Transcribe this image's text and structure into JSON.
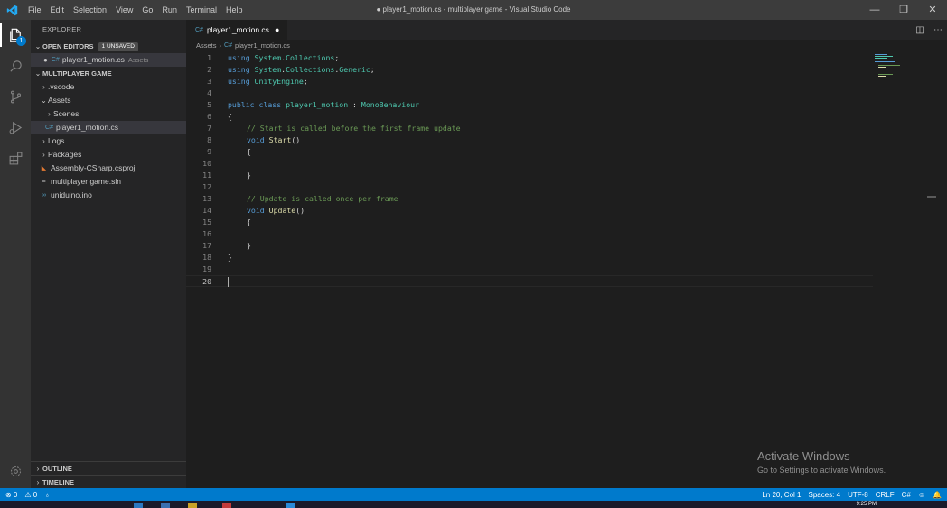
{
  "titlebar": {
    "menu": [
      "File",
      "Edit",
      "Selection",
      "View",
      "Go",
      "Run",
      "Terminal",
      "Help"
    ],
    "window_title": "● player1_motion.cs - multiplayer game - Visual Studio Code",
    "controls": [
      "—",
      "❐",
      "✕"
    ]
  },
  "activitybar": {
    "explorer_badge": "1"
  },
  "sidebar": {
    "title": "EXPLORER",
    "open_editors": {
      "label": "OPEN EDITORS",
      "badge": "1 UNSAVED",
      "file": "player1_motion.cs",
      "desc": "Assets"
    },
    "workspace": {
      "label": "MULTIPLAYER GAME"
    },
    "tree": {
      "vscode": ".vscode",
      "assets": "Assets",
      "scenes": "Scenes",
      "player_motion": "player1_motion.cs",
      "logs": "Logs",
      "packages": "Packages",
      "csproj": "Assembly-CSharp.csproj",
      "sln": "multiplayer game.sln",
      "ino": "uniduino.ino"
    },
    "outline": "OUTLINE",
    "timeline": "TIMELINE"
  },
  "editor": {
    "tab_label": "player1_motion.cs",
    "tab_modified": "●",
    "breadcrumb": {
      "folder": "Assets",
      "file": "player1_motion.cs"
    },
    "line_numbers": [
      "1",
      "2",
      "3",
      "4",
      "5",
      "6",
      "7",
      "8",
      "9",
      "10",
      "11",
      "12",
      "13",
      "14",
      "15",
      "16",
      "17",
      "18",
      "19",
      "20"
    ],
    "code": {
      "l1_kw": "using",
      "l1_ns": "System",
      "l1_dot": ".",
      "l1_ns2": "Collections",
      "l1_end": ";",
      "l2_kw": "using",
      "l2_ns": "System",
      "l2_dot": ".",
      "l2_ns2": "Collections",
      "l2_dot2": ".",
      "l2_ns3": "Generic",
      "l2_end": ";",
      "l3_kw": "using",
      "l3_ns": "UnityEngine",
      "l3_end": ";",
      "l5_kw1": "public",
      "l5_kw2": "class",
      "l5_name": "player1_motion",
      "l5_colon": " : ",
      "l5_base": "MonoBehaviour",
      "l6": "{",
      "l7": "// Start is called before the first frame update",
      "l8_kw": "void",
      "l8_fn": "Start",
      "l8_p": "()",
      "l9": "{",
      "l11": "}",
      "l13": "// Update is called once per frame",
      "l14_kw": "void",
      "l14_fn": "Update",
      "l14_p": "()",
      "l15": "{",
      "l17": "}",
      "l18": "}"
    }
  },
  "watermark": {
    "title": "Activate Windows",
    "subtitle": "Go to Settings to activate Windows."
  },
  "statusbar": {
    "errors": "⊗ 0",
    "warnings": "⚠ 0",
    "live": "♁",
    "position": "Ln 20, Col 1",
    "spaces": "Spaces: 4",
    "encoding": "UTF-8",
    "eol": "CRLF",
    "language": "C#",
    "feedback": "☺",
    "notifications": "🔔"
  },
  "taskbar": {
    "clock": "9:25 PM"
  },
  "colors": {
    "accent": "#007acc",
    "editor_bg": "#1e1e1e",
    "sidebar_bg": "#252526",
    "activity_bg": "#333333"
  }
}
